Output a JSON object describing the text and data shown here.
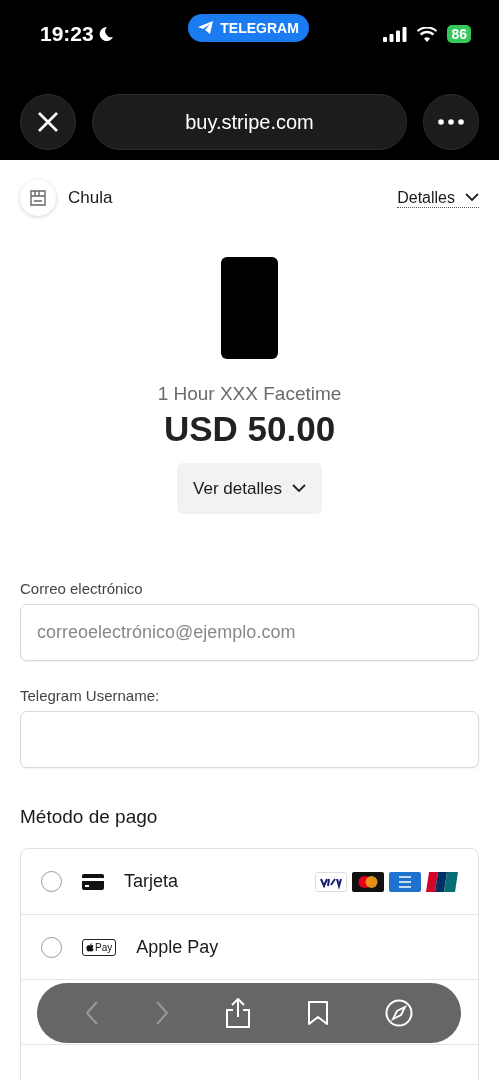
{
  "status_bar": {
    "time": "19:23",
    "pill": "TELEGRAM",
    "battery": "86"
  },
  "browser": {
    "url": "buy.stripe.com"
  },
  "merchant": {
    "name": "Chula",
    "details_link": "Detalles"
  },
  "product": {
    "name": "1 Hour XXX Facetime",
    "price": "USD 50.00",
    "details_button": "Ver detalles"
  },
  "form": {
    "fields": [
      {
        "label": "Correo electrónico",
        "placeholder": "correoelectrónico@ejemplo.com"
      },
      {
        "label": "Telegram Username:"
      }
    ]
  },
  "payment": {
    "title": "Método de pago",
    "methods": [
      {
        "kind": "card",
        "label": "Tarjeta",
        "selected": false
      },
      {
        "kind": "applepay",
        "label": "Apple Pay",
        "badge": "Pay",
        "selected": false
      }
    ]
  }
}
